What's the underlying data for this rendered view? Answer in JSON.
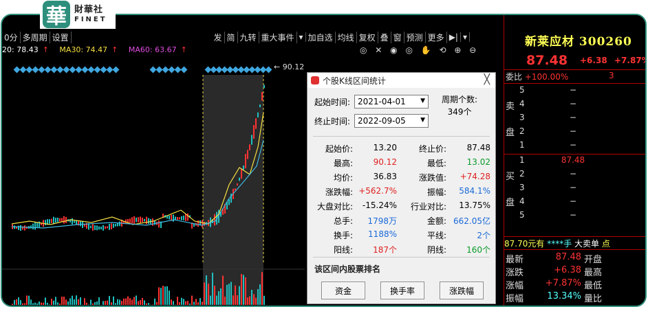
{
  "brand": {
    "seal_char": "華",
    "name_cn": "財華社",
    "name_en": "FINET"
  },
  "toolbar": {
    "left": [
      "0分",
      "多周期",
      "设置"
    ],
    "right": [
      "发",
      "简",
      "九转",
      "重大事件",
      "▾",
      "加自选",
      "均线",
      "复权",
      "叠",
      "窗",
      "预测",
      "更多",
      "▶|",
      "▾"
    ]
  },
  "ma": {
    "ma20": "20: 78.43",
    "ma30": "MA30: 74.47",
    "ma60": "MA60: 63.67",
    "arrow": "↑"
  },
  "chart_icons": "◎ ✕ ◉ ◎ ✋ ⟲ ⊕ ⊖",
  "high_marker": "90.12",
  "dialog": {
    "title": "个股K线区间统计",
    "close": "╳",
    "start_label": "起始时间:",
    "start_value": "2021-04-01",
    "end_label": "终止时间:",
    "end_value": "2022-09-05",
    "period_label": "周期个数:",
    "period_value": "349个",
    "stats": [
      {
        "l1": "起始价:",
        "v1": "13.20",
        "c1": "dark",
        "l2": "终止价:",
        "v2": "87.48",
        "c2": "dark"
      },
      {
        "l1": "最高:",
        "v1": "90.12",
        "c1": "red",
        "l2": "最低:",
        "v2": "13.02",
        "c2": "green"
      },
      {
        "l1": "均价:",
        "v1": "36.83",
        "c1": "dark",
        "l2": "涨跌值:",
        "v2": "+74.28",
        "c2": "red"
      },
      {
        "l1": "涨跌幅:",
        "v1": "+562.7%",
        "c1": "red",
        "l2": "振幅:",
        "v2": "584.1%",
        "c2": "blue"
      },
      {
        "l1": "大盘对比:",
        "v1": "-15.24%",
        "c1": "dark",
        "l2": "行业对比:",
        "v2": "13.75%",
        "c2": "dark"
      },
      {
        "l1": "总手:",
        "v1": "1798万",
        "c1": "blue",
        "l2": "金额:",
        "v2": "662.05亿",
        "c2": "blue"
      },
      {
        "l1": "换手:",
        "v1": "1188%",
        "c1": "blue",
        "l2": "平线:",
        "v2": "2个",
        "c2": "blue"
      },
      {
        "l1": "阳线:",
        "v1": "187个",
        "c1": "red",
        "l2": "阴线:",
        "v2": "160个",
        "c2": "green"
      }
    ],
    "rank_title": "该区间内股票排名",
    "buttons": [
      "资金",
      "换手率",
      "涨跌幅"
    ]
  },
  "quote": {
    "name": "新莱应材 300260",
    "price": "87.48",
    "change": "+6.38",
    "pct": "+7.87%",
    "weibi_label": "委比",
    "weibi_value": "+100.00%",
    "weibi_count": "3",
    "sell_side": [
      "卖",
      "盘"
    ],
    "buy_side": [
      "买",
      "盘"
    ],
    "sell_levels": [
      "5",
      "4",
      "3",
      "2",
      "1"
    ],
    "buy_levels": [
      "1",
      "2",
      "3",
      "4",
      "5"
    ],
    "dash": "−",
    "buy1_price": "87.48",
    "tick": {
      "price": "87.70元有",
      "stars": "****手",
      "type": "大卖单",
      "more": "点"
    },
    "rows": [
      {
        "k": "最新",
        "v": "87.48",
        "vc": "#ff3333",
        "k2": "开盘"
      },
      {
        "k": "涨跌",
        "v": "+6.38",
        "vc": "#ff3333",
        "k2": "最高"
      },
      {
        "k": "涨幅",
        "v": "+7.87%",
        "vc": "#ff3333",
        "k2": "最低"
      },
      {
        "k": "振幅",
        "v": "13.34%",
        "vc": "#55ffff",
        "k2": "量比"
      }
    ]
  },
  "colors": {
    "accent": "#2e8f7c",
    "up": "#ff3333",
    "down": "#0a9a2a",
    "blue": "#1a6ad8"
  }
}
